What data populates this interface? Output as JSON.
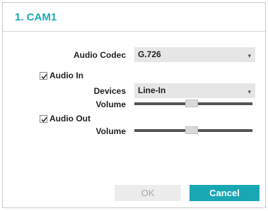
{
  "dialog": {
    "title": "1. CAM1"
  },
  "audio_codec": {
    "label": "Audio Codec",
    "value": "G.726",
    "arrow": "▾"
  },
  "audio_in": {
    "label": "Audio In",
    "checked": true,
    "devices_label": "Devices",
    "devices_value": "Line-In",
    "arrow": "▾",
    "volume_label": "Volume",
    "volume": 0.48
  },
  "audio_out": {
    "label": "Audio Out",
    "checked": true,
    "volume_label": "Volume",
    "volume": 0.48
  },
  "buttons": {
    "ok_label": "OK",
    "cancel_label": "Cancel"
  },
  "colors": {
    "accent": "#1aa7b4",
    "title": "#1ba8b5"
  },
  "icons": {
    "checkbox": "checkbox-checked-icon",
    "dropdown": "chevron-down-icon"
  }
}
